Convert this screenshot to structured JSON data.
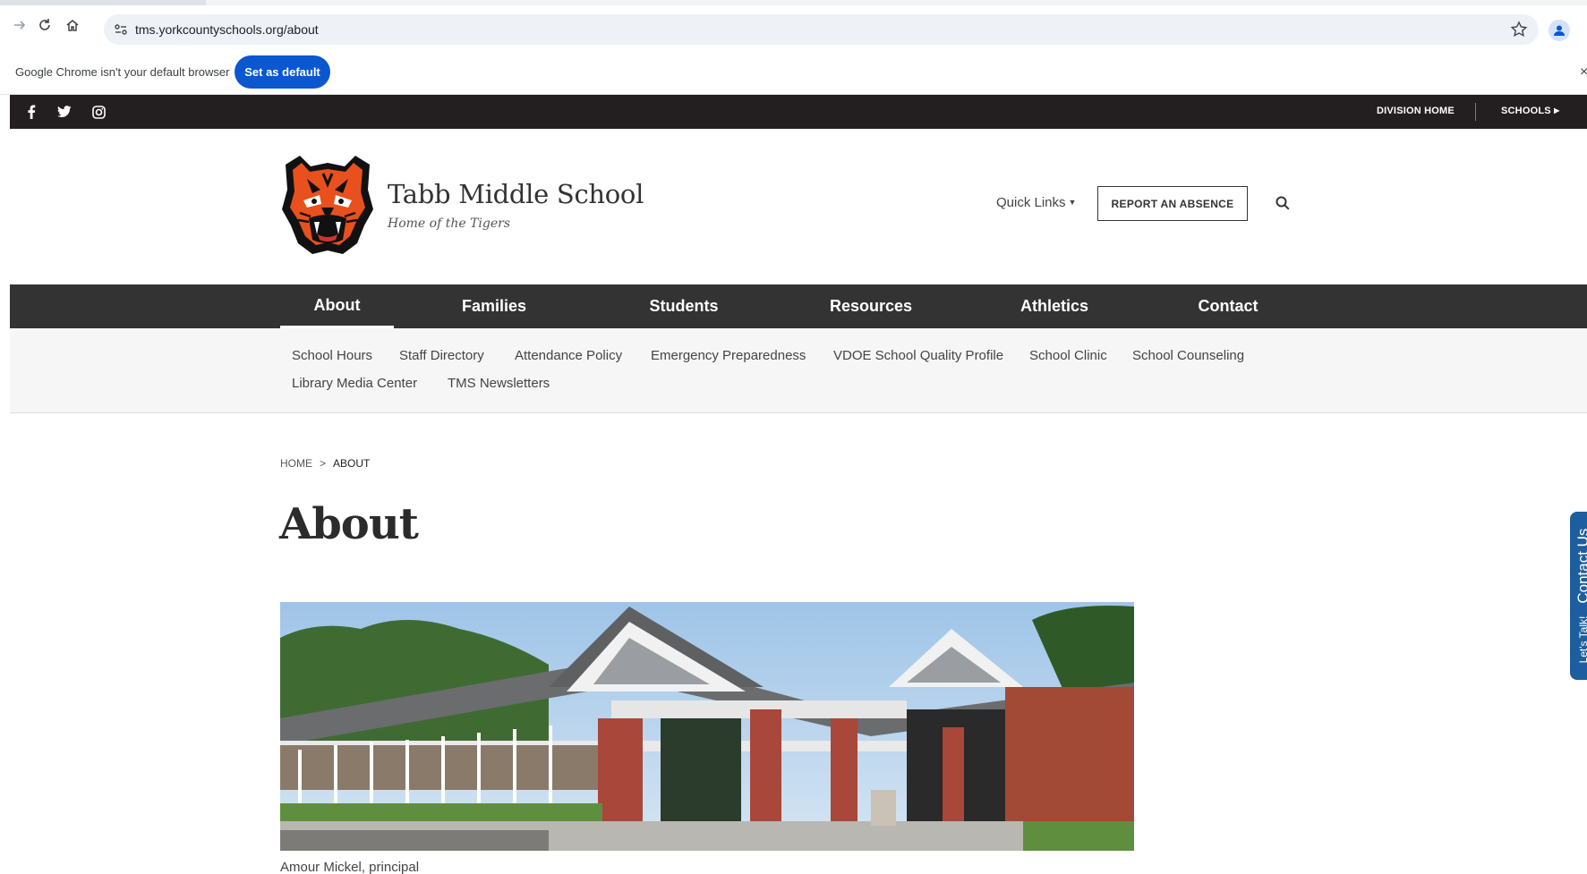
{
  "browser": {
    "url": "tms.yorkcountyschools.org/about",
    "infobar_message": "Google Chrome isn't your default browser",
    "set_default_label": "Set as default",
    "close_label": "×"
  },
  "utility": {
    "division_home": "DIVISION HOME",
    "schools": "SCHOOLS"
  },
  "header": {
    "school_name": "Tabb Middle School",
    "tagline": "Home of the Tigers",
    "quick_links": "Quick Links",
    "report_absence": "REPORT AN ABSENCE"
  },
  "main_nav": [
    {
      "label": "About",
      "active": true
    },
    {
      "label": "Families"
    },
    {
      "label": "Students"
    },
    {
      "label": "Resources"
    },
    {
      "label": "Athletics"
    },
    {
      "label": "Contact"
    }
  ],
  "sub_nav": [
    "School Hours",
    "Staff Directory",
    "Attendance Policy",
    "Emergency Preparedness",
    "VDOE School Quality Profile",
    "School Clinic",
    "School Counseling",
    "Library Media Center",
    "TMS Newsletters"
  ],
  "breadcrumb": {
    "home": "HOME",
    "separator": ">",
    "current": "ABOUT"
  },
  "page": {
    "title": "About",
    "photo_caption": "Amour Mickel, principal"
  },
  "contact_tab": {
    "label": "Contact Us",
    "sublabel": "Let's Talk!"
  },
  "colors": {
    "utility_bar": "#231f20",
    "main_nav": "#333333",
    "subnav_bg": "#f6f6f6",
    "chrome_button": "#0b57d0",
    "contact_tab": "#1d5f9e"
  }
}
